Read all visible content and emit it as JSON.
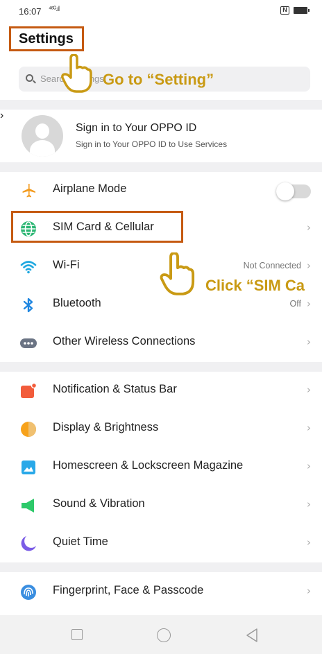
{
  "status_bar": {
    "time": "16:07",
    "signal": "⁴⁶ᴳ.ıl"
  },
  "header": {
    "title": "Settings"
  },
  "search": {
    "placeholder": "Search Settings"
  },
  "account": {
    "title": "Sign in to Your OPPO ID",
    "subtitle": "Sign in to Your OPPO ID to Use Services"
  },
  "group1": [
    {
      "label": "Airplane Mode",
      "icon": "airplane-icon"
    },
    {
      "label": "SIM Card & Cellular",
      "icon": "globe-icon"
    },
    {
      "label": "Wi-Fi",
      "icon": "wifi-icon",
      "value": "Not Connected"
    },
    {
      "label": "Bluetooth",
      "icon": "bluetooth-icon",
      "value": "Off"
    },
    {
      "label": "Other Wireless Connections",
      "icon": "more-dots-icon"
    }
  ],
  "group2": [
    {
      "label": "Notification & Status Bar",
      "icon": "notification-icon"
    },
    {
      "label": "Display & Brightness",
      "icon": "brightness-icon"
    },
    {
      "label": "Homescreen & Lockscreen Magazine",
      "icon": "image-icon"
    },
    {
      "label": "Sound & Vibration",
      "icon": "speaker-icon"
    },
    {
      "label": "Quiet Time",
      "icon": "moon-icon"
    }
  ],
  "group3": [
    {
      "label": "Fingerprint, Face & Passcode",
      "icon": "fingerprint-icon"
    }
  ],
  "annotations": {
    "goto": "Go to “Setting”",
    "click": "Click “SIM Ca"
  },
  "colors": {
    "highlight": "#c55a11",
    "annotation": "#c99a14"
  }
}
